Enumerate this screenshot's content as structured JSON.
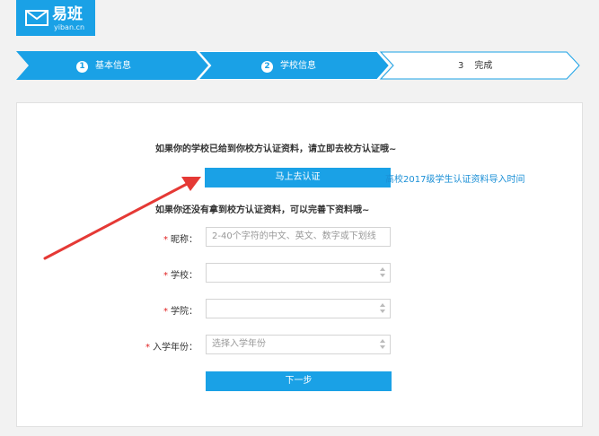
{
  "header": {
    "brand": "易班",
    "sub": "yiban.cn"
  },
  "steps": [
    {
      "num": "1",
      "label": "基本信息",
      "state": "done"
    },
    {
      "num": "2",
      "label": "学校信息",
      "state": "current"
    },
    {
      "num": "3",
      "label": "完成",
      "state": "todo"
    }
  ],
  "main": {
    "hint_verified": "如果你的学校已给到你校方认证资料，请立即去校方认证哦~",
    "verify_button": "马上去认证",
    "import_link": "高校2017级学生认证资料导入时间",
    "hint_unverified": "如果你还没有拿到校方认证资料，可以完善下资料哦~",
    "required_mark": "*",
    "nickname": {
      "label": "昵称：",
      "placeholder": "2-40个字符的中文、英文、数字或下划线"
    },
    "school": {
      "label": "学校：",
      "value": ""
    },
    "college": {
      "label": "学院：",
      "value": ""
    },
    "year": {
      "label": "入学年份：",
      "value": "选择入学年份"
    },
    "next_button": "下一步"
  },
  "colors": {
    "accent": "#1aa1e6",
    "arrow": "#e53935",
    "required": "#e02020"
  }
}
